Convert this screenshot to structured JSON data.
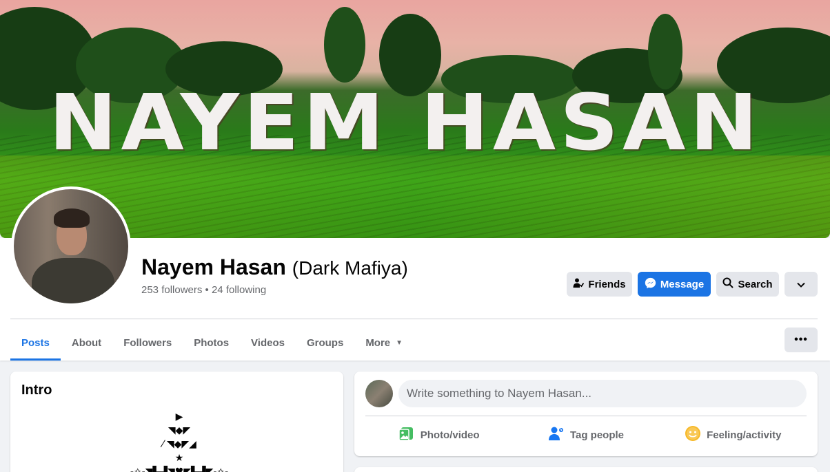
{
  "cover": {
    "text": "NAYEM HASAN"
  },
  "profile": {
    "name": "Nayem Hasan",
    "alt_name": "(Dark Mafiya)",
    "follow_info": "253 followers • 24 following"
  },
  "actions": {
    "friends_label": "Friends",
    "message_label": "Message",
    "search_label": "Search",
    "more_icon": "chevron-down-icon"
  },
  "tabs": [
    {
      "label": "Posts",
      "active": true
    },
    {
      "label": "About"
    },
    {
      "label": "Followers"
    },
    {
      "label": "Photos"
    },
    {
      "label": "Videos"
    },
    {
      "label": "Groups"
    },
    {
      "label": "More"
    }
  ],
  "tab_menu_label": "•••",
  "intro": {
    "title": "Intro",
    "bio": "▶\n◥◆◤\n⁄ ◥◆◤◢\n★\n-✧-◥▙▟◥♥◤▙▟◤-✧-"
  },
  "composer": {
    "placeholder": "Write something to Nayem Hasan...",
    "actions": [
      {
        "label": "Photo/video",
        "icon": "photo-icon",
        "color": "#45bd62"
      },
      {
        "label": "Tag people",
        "icon": "tag-people-icon",
        "color": "#1877f2"
      },
      {
        "label": "Feeling/activity",
        "icon": "feeling-icon",
        "color": "#f7b928"
      }
    ]
  },
  "colors": {
    "accent": "#1b74e4",
    "secondary_text": "#65676b"
  }
}
